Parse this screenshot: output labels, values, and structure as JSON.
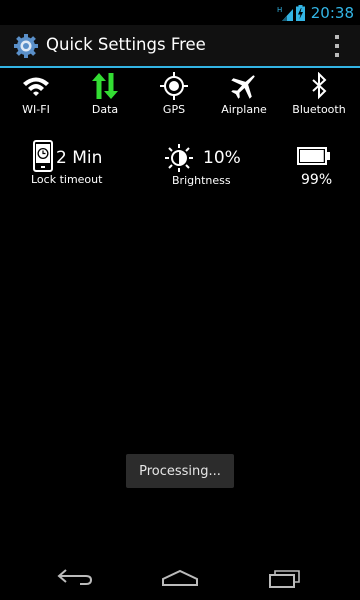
{
  "status_bar": {
    "network_type": "H",
    "clock": "20:38",
    "signal_icon": "signal-bars-icon",
    "battery_icon": "battery-charging-icon"
  },
  "action_bar": {
    "title": "Quick Settings Free",
    "app_icon": "gear-icon",
    "menu_icon": "overflow-menu-icon"
  },
  "toggles": [
    {
      "label": "WI-FI",
      "icon": "wifi-icon",
      "active": false
    },
    {
      "label": "Data",
      "icon": "data-arrows-icon",
      "active": true
    },
    {
      "label": "GPS",
      "icon": "gps-icon",
      "active": false
    },
    {
      "label": "Airplane",
      "icon": "airplane-icon",
      "active": false
    },
    {
      "label": "Bluetooth",
      "icon": "bluetooth-icon",
      "active": false
    }
  ],
  "info": {
    "lock_timeout": {
      "value": "2 Min",
      "label": "Lock timeout",
      "icon": "phone-clock-icon"
    },
    "brightness": {
      "value": "10%",
      "label": "Brightness",
      "icon": "sun-icon"
    },
    "battery": {
      "value": "99%",
      "icon": "battery-icon",
      "level": 0.99
    }
  },
  "toast": {
    "text": "Processing..."
  },
  "nav_bar": {
    "back_icon": "back-icon",
    "home_icon": "home-icon",
    "recents_icon": "recents-icon"
  },
  "colors": {
    "accent": "#33b5e5",
    "data_active": "#33dd33",
    "background": "#000000"
  }
}
